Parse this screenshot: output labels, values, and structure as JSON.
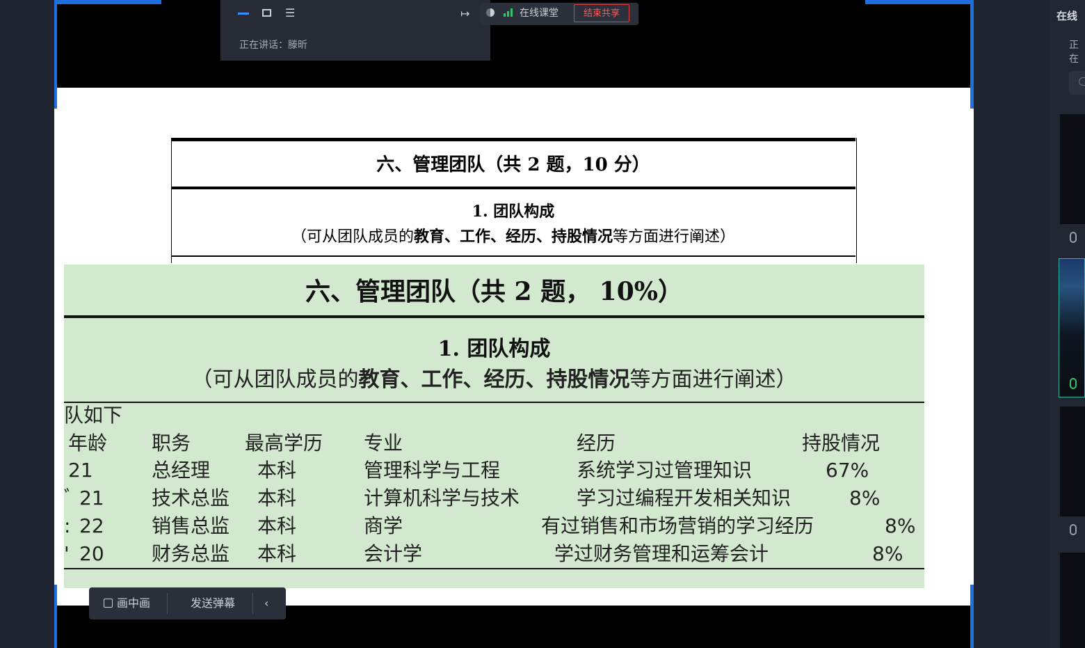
{
  "toolbar": {
    "minimize_icon": "minimize-icon",
    "window_icon": "window-icon",
    "menu_icon": "menu-icon",
    "speaking_label": "正在讲话：",
    "speaker_name": "滕昕",
    "online_label": "在线课堂",
    "end_share_label": "结束共享"
  },
  "doc": {
    "title": "六、管理团队（共 2 题，10 分）",
    "subtitle": "1. 团队构成",
    "desc_prefix": "（可从团队成员的",
    "desc_bold": "教育、工作、经历、持股情况",
    "desc_suffix": "等方面进行阐述）"
  },
  "green": {
    "title": "六、管理团队（共 2 题， 10%）",
    "subtitle": "1. 团队构成",
    "desc_prefix": "（可从团队成员的",
    "desc_bold": "教育、工作、经历、持股情况",
    "desc_suffix": "等方面进行阐述）",
    "intro": "队如下",
    "headers": [
      "年龄",
      "职务",
      "最高学历",
      "专业",
      "经历",
      "持股情况"
    ],
    "rows": [
      {
        "lead": "",
        "age": "21",
        "role": "总经理",
        "degree": "本科",
        "major": "管理科学与工程",
        "exp": "系统学习过管理知识",
        "share": "67%"
      },
      {
        "lead": "ﾞ",
        "age": "21",
        "role": "技术总监",
        "degree": "本科",
        "major": "计算机科学与技术",
        "exp": "学习过编程开发相关知识",
        "share": "8%"
      },
      {
        "lead": ":",
        "age": "22",
        "role": "销售总监",
        "degree": "本科",
        "major": "商学",
        "exp": "有过销售和市场营销的学习经历",
        "share": "8%"
      },
      {
        "lead": "'",
        "age": "20",
        "role": "财务总监",
        "degree": "本科",
        "major": "会计学",
        "exp": "学过财务管理和运筹会计",
        "share": "8%"
      }
    ]
  },
  "bottom": {
    "pip_label": "画中画",
    "danmaku_label": "发送弹幕",
    "collapse_icon": "chevron-left-icon"
  },
  "right_panel": {
    "title": "在线",
    "status": "正在"
  },
  "colors": {
    "accent_blue": "#1f6fe0",
    "green_bg": "#d2e8cf",
    "end_share_red": "#e04040",
    "mic_green": "#34c36a"
  }
}
